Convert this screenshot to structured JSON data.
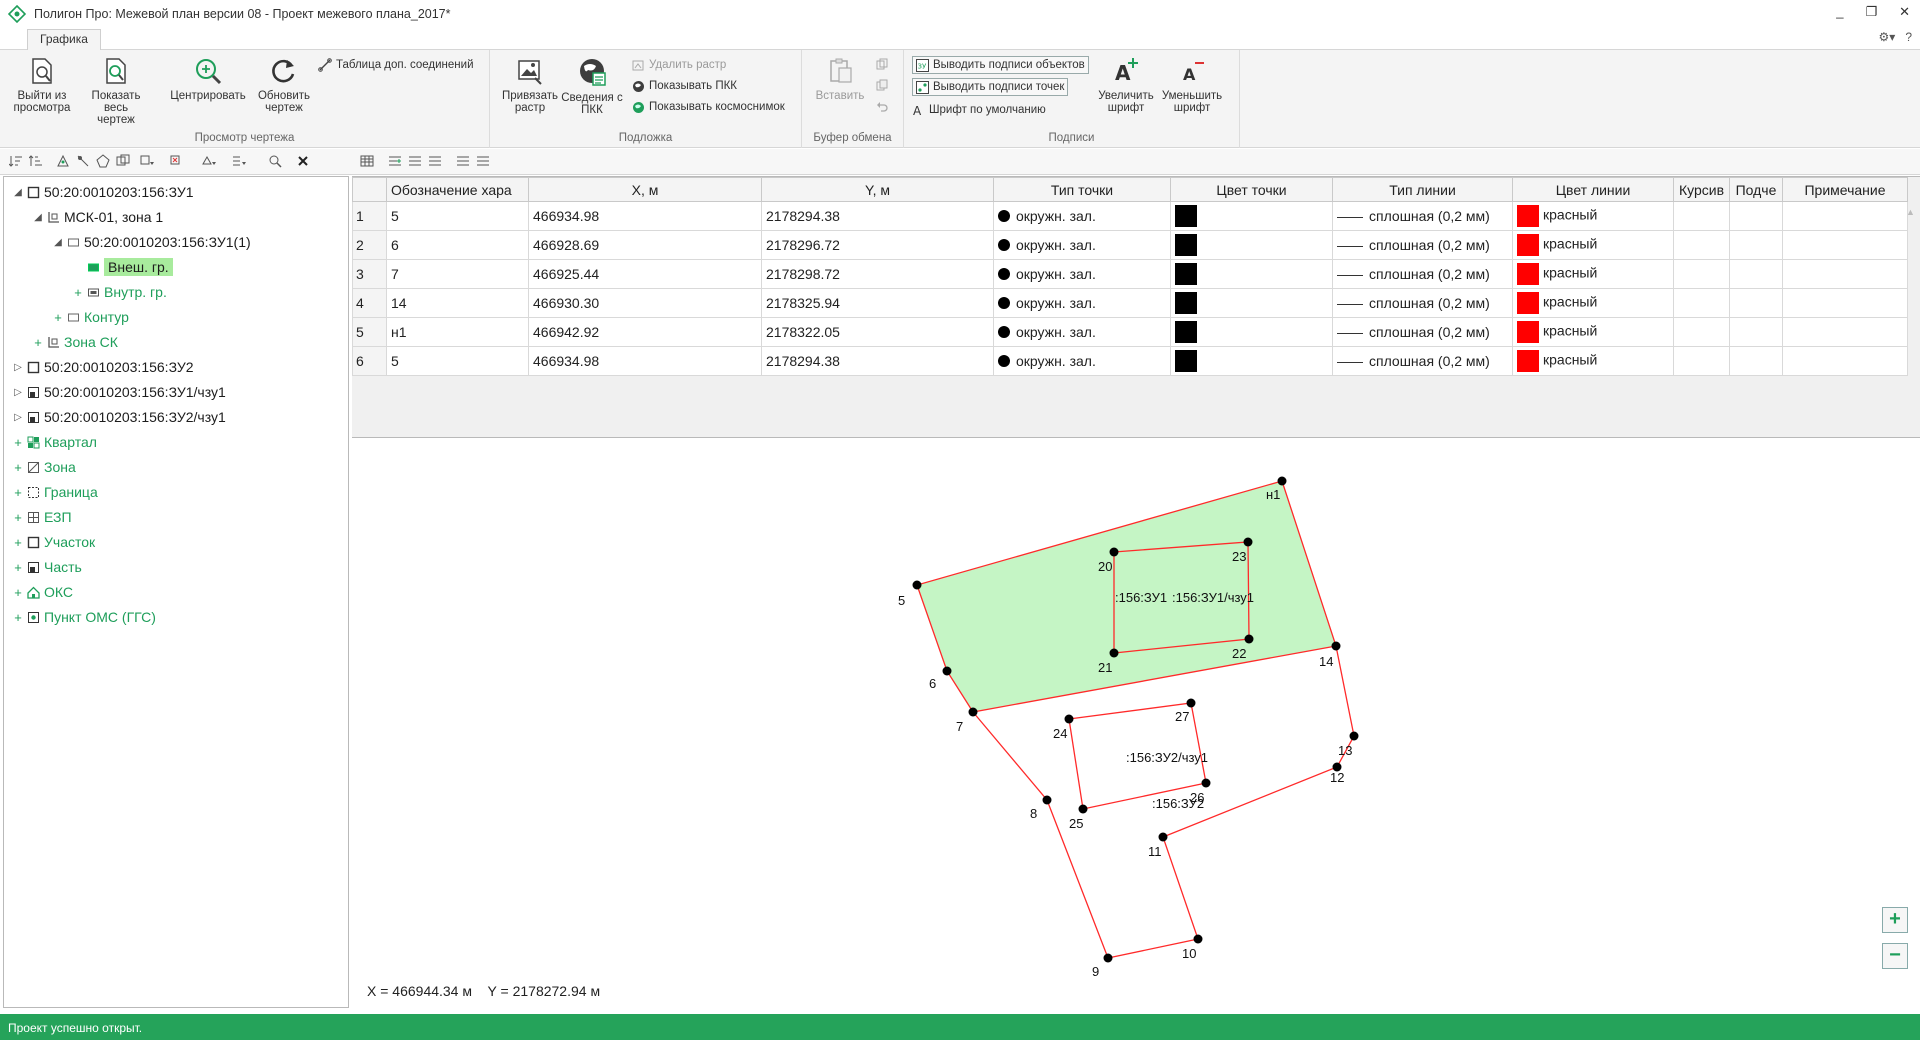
{
  "window": {
    "title": "Полигон Про: Межевой план версии 08 - Проект межевого плана_2017*",
    "controls": [
      "_",
      "❐",
      "✕"
    ]
  },
  "ribbon": {
    "active_tab": "Графика",
    "help_icons": [
      "⚙▾",
      "?"
    ],
    "groups": {
      "view": {
        "label": "Просмотр чертежа",
        "exit_preview": "Выйти из просмотра",
        "show_all": "Показать весь чертеж",
        "center": "Центрировать",
        "refresh": "Обновить чертеж",
        "extra_connections": "Таблица доп. соединений"
      },
      "underlay": {
        "label": "Подложка",
        "bind_raster": "Привязать растр",
        "pkk_info": "Сведения с ПКК",
        "delete_raster": "Удалить растр",
        "show_pkk": "Показывать ПКК",
        "show_satellite": "Показывать космоснимок"
      },
      "clipboard": {
        "label": "Буфер обмена",
        "paste": "Вставить"
      },
      "captions": {
        "label": "Подписи",
        "show_object_captions": "Выводить подписи объектов",
        "show_point_captions": "Выводить подписи точек",
        "default_font": "Шрифт по умолчанию",
        "increase_font": "Увеличить шрифт",
        "decrease_font": "Уменьшить шрифт"
      }
    }
  },
  "tree": {
    "items": [
      {
        "label": "50:20:0010203:156:ЗУ1",
        "level": 0,
        "expander": "◢",
        "style": "dark",
        "icon": "square-icon"
      },
      {
        "label": "МСК-01, зона 1",
        "level": 1,
        "expander": "◢",
        "style": "dark",
        "icon": "crs-icon"
      },
      {
        "label": "50:20:0010203:156:ЗУ1(1)",
        "level": 2,
        "expander": "◢",
        "style": "dark",
        "icon": "contour-icon"
      },
      {
        "label": "Внеш. гр.",
        "level": 3,
        "expander": "",
        "style": "dark",
        "icon": "outer-border-icon",
        "selected": true
      },
      {
        "label": "Внутр. гр.",
        "level": 3,
        "expander": "+",
        "style": "green",
        "icon": "inner-border-icon"
      },
      {
        "label": "Контур",
        "level": 2,
        "expander": "+",
        "style": "green",
        "icon": "contour-icon"
      },
      {
        "label": "Зона СК",
        "level": 1,
        "expander": "+",
        "style": "green",
        "icon": "crs-icon"
      },
      {
        "label": "50:20:0010203:156:ЗУ2",
        "level": 0,
        "expander": "▷",
        "style": "dark",
        "icon": "square-icon"
      },
      {
        "label": "50:20:0010203:156:ЗУ1/чзу1",
        "level": 0,
        "expander": "▷",
        "style": "dark",
        "icon": "part-icon"
      },
      {
        "label": "50:20:0010203:156:ЗУ2/чзу1",
        "level": 0,
        "expander": "▷",
        "style": "dark",
        "icon": "part-icon"
      },
      {
        "label": "Квартал",
        "level": 0,
        "expander": "+",
        "style": "green",
        "icon": "quarter-icon"
      },
      {
        "label": "Зона",
        "level": 0,
        "expander": "+",
        "style": "green",
        "icon": "zone-icon"
      },
      {
        "label": "Граница",
        "level": 0,
        "expander": "+",
        "style": "green",
        "icon": "border-icon"
      },
      {
        "label": "ЕЗП",
        "level": 0,
        "expander": "+",
        "style": "green",
        "icon": "ezp-icon"
      },
      {
        "label": "Участок",
        "level": 0,
        "expander": "+",
        "style": "green",
        "icon": "square-icon"
      },
      {
        "label": "Часть",
        "level": 0,
        "expander": "+",
        "style": "green",
        "icon": "part-icon"
      },
      {
        "label": "ОКС",
        "level": 0,
        "expander": "+",
        "style": "green",
        "icon": "house-icon"
      },
      {
        "label": "Пункт ОМС (ГГС)",
        "level": 0,
        "expander": "+",
        "style": "green",
        "icon": "point-icon"
      }
    ]
  },
  "grid": {
    "columns": [
      "",
      "Обозначение хара",
      "X, м",
      "Y, м",
      "Тип точки",
      "Цвет точки",
      "Тип линии",
      "Цвет линии",
      "Курсив",
      "Подче",
      "Примечание"
    ],
    "rows": [
      {
        "n": "1",
        "name": "5",
        "x": "466934.98",
        "y": "2178294.38",
        "point_type": "окружн. зал.",
        "line_type": "сплошная (0,2 мм)",
        "line_color": "красный"
      },
      {
        "n": "2",
        "name": "6",
        "x": "466928.69",
        "y": "2178296.72",
        "point_type": "окружн. зал.",
        "line_type": "сплошная (0,2 мм)",
        "line_color": "красный"
      },
      {
        "n": "3",
        "name": "7",
        "x": "466925.44",
        "y": "2178298.72",
        "point_type": "окружн. зал.",
        "line_type": "сплошная (0,2 мм)",
        "line_color": "красный"
      },
      {
        "n": "4",
        "name": "14",
        "x": "466930.30",
        "y": "2178325.94",
        "point_type": "окружн. зал.",
        "line_type": "сплошная (0,2 мм)",
        "line_color": "красный"
      },
      {
        "n": "5",
        "name": "н1",
        "x": "466942.92",
        "y": "2178322.05",
        "point_type": "окружн. зал.",
        "line_type": "сплошная (0,2 мм)",
        "line_color": "красный"
      },
      {
        "n": "6",
        "name": "5",
        "x": "466934.98",
        "y": "2178294.38",
        "point_type": "окружн. зал.",
        "line_type": "сплошная (0,2 мм)",
        "line_color": "красный"
      }
    ],
    "point_color": "#000000",
    "line_color_hex": "#ff0000"
  },
  "drawing": {
    "point_labels": [
      "н1",
      "5",
      "6",
      "7",
      "14",
      "20",
      "23",
      "21",
      "22",
      "24",
      "27",
      "26",
      "25",
      "13",
      "12",
      "11",
      "8",
      "9",
      "10"
    ],
    "parcel_labels": [
      ":156:ЗУ1",
      ":156:ЗУ1/чзу1",
      ":156:ЗУ2/чзу1",
      ":156:ЗУ2"
    ],
    "fill_color": "#c5f5c5",
    "line_color": "#ff2a2a",
    "point_color": "#000000"
  },
  "coords": {
    "text": "X = 466944.34 м    Y = 2178272.94 м"
  },
  "zoom": {
    "in": "+",
    "out": "−"
  },
  "status": {
    "text": "Проект успешно открыт.",
    "color": "#25a35a"
  },
  "colors": {
    "accent": "#1e9e5a",
    "selection": "#a8eb9d"
  }
}
